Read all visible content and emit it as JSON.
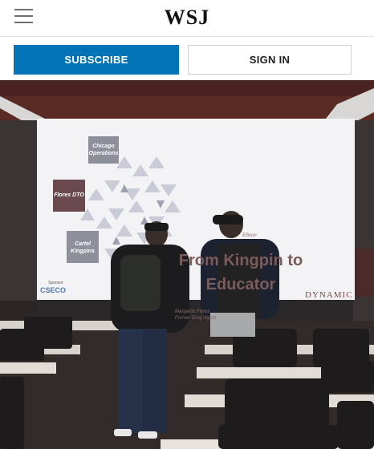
{
  "header": {
    "logo": "WSJ",
    "menu_icon": "hamburger-menu-icon"
  },
  "actions": {
    "subscribe_label": "SUBSCRIBE",
    "signin_label": "SIGN IN"
  },
  "photo": {
    "slide_title": "From Kingpin to Educator",
    "slide_title_line1": "From Kingpin to",
    "slide_title_line2": "Educator",
    "tags": {
      "tag1": "Chicago Operations",
      "tag2": "Flores DTO",
      "tag3": "Cartel Kingpins"
    },
    "presenter_name": "Margarito Flores",
    "presenter_role": "Former Drug Agent",
    "presenter_extra": "Ellison",
    "sponsor_label": "Sponsor",
    "sponsor_name": "CSECO",
    "brand": "DYNAMIC"
  },
  "colors": {
    "brand_blue": "#0274b6",
    "slide_text": "#7a5c5c"
  }
}
